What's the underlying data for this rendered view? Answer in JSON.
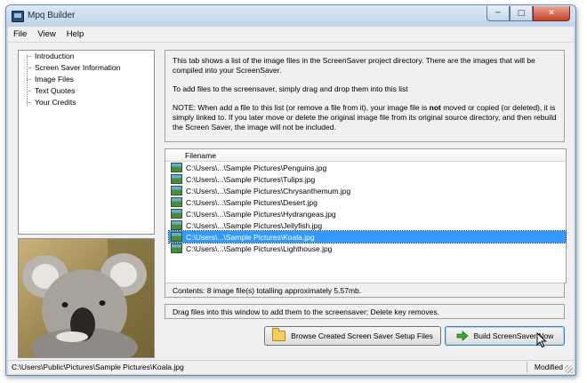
{
  "window": {
    "title": "Mpq Builder"
  },
  "menu": [
    "File",
    "View",
    "Help"
  ],
  "tree": [
    "Introduction",
    "Screen Saver Information",
    "Image Files",
    "Text Quotes",
    "Your Credits"
  ],
  "info": {
    "p1": "This tab shows a list of the image files in the ScreenSaver project directory. There are the images that will be compiled into your ScreenSaver.",
    "p2": "To add files to the screensaver, simply drag and drop them into this list",
    "p3a": "NOTE: When add a file to this list (or remove a file from it), your image file is ",
    "p3b": "not",
    "p3c": " moved or copied (or deleted), it is simply linked to. If you later move or delete the original image file from its original source directory, and then rebuild the Screen Saver, the image will not be included."
  },
  "files": {
    "column": "Filename",
    "items": [
      "C:\\Users\\...\\Sample Pictures\\Penguins.jpg",
      "C:\\Users\\...\\Sample Pictures\\Tulips.jpg",
      "C:\\Users\\...\\Sample Pictures\\Chrysanthemum.jpg",
      "C:\\Users\\...\\Sample Pictures\\Desert.jpg",
      "C:\\Users\\...\\Sample Pictures\\Hydrangeas.jpg",
      "C:\\Users\\...\\Sample Pictures\\Jellyfish.jpg",
      "C:\\Users\\...\\Sample Pictures\\Koala.jpg",
      "C:\\Users\\...\\Sample Pictures\\Lighthouse.jpg"
    ],
    "selected_index": 6,
    "contents": "Contents: 8 image file(s) totalling approximately 5.57mb."
  },
  "hint": "Drag files into this window to add them to the screensaver; Delete key removes.",
  "buttons": {
    "browse": "Browse Created Screen Saver Setup Files",
    "build": "Build ScreenSaver Now"
  },
  "status": {
    "path": "C:\\Users\\Public\\Pictures\\Sample Pictures\\Koala.jpg",
    "state": "Modified"
  },
  "icons": {
    "app": "app-icon",
    "folder": "folder-icon",
    "build": "green-arrow-icon",
    "file": "image-thumbnail-icon"
  },
  "colors": {
    "selection": "#3399ff",
    "close_button": "#c7412a",
    "build_arrow": "#3ea634"
  }
}
